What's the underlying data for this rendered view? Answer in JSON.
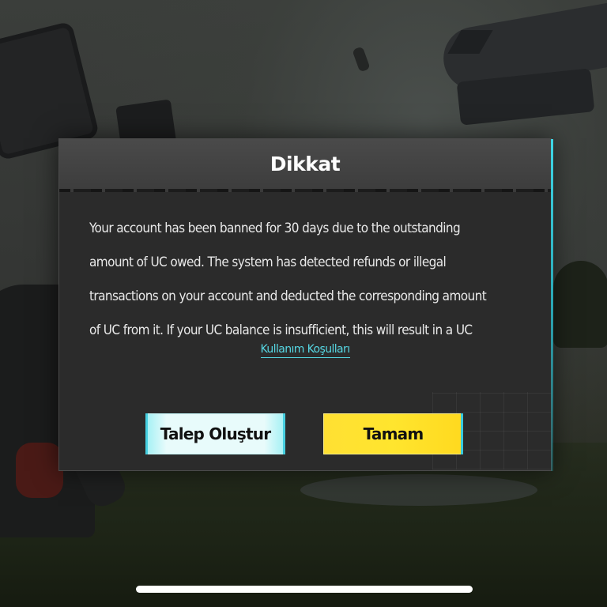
{
  "dialog": {
    "title": "Dikkat",
    "body_lines": [
      "Your account has been banned for 30 days due to the outstanding",
      "amount of UC owed. The system has detected refunds or illegal",
      "transactions on your account and deducted the corresponding amount",
      "of UC from it. If your UC balance is insufficient, this will result in a UC"
    ],
    "terms_link": "Kullanım Koşulları",
    "buttons": {
      "secondary_label": "Talep Oluştur",
      "primary_label": "Tamam"
    }
  },
  "colors": {
    "accent_cyan": "#56d7e3",
    "primary_button": "#ffe52e",
    "secondary_button": "#e8fbfb",
    "dialog_bg": "#2b2b2b"
  }
}
